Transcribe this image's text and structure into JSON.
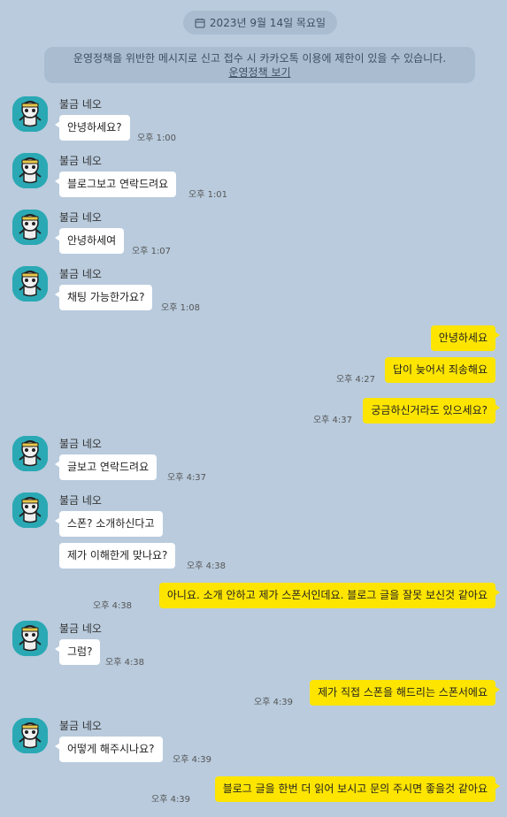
{
  "date_label": "2023년 9월 14일 목요일",
  "notice": {
    "text": "운영정책을 위반한 메시지로 신고 접수 시 카카오톡 이용에 제한이 있을 수 있습니다.",
    "link": "운영정책 보기"
  },
  "sender_name": "불금 네오",
  "messages": [
    {
      "text": "안녕하세요?",
      "time": "오후 1:00"
    },
    {
      "text": "블로그보고 연락드려요",
      "time": "오후 1:01"
    },
    {
      "text": "안녕하세여",
      "time": "오후 1:07"
    },
    {
      "text": "채팅 가능한가요?",
      "time": "오후 1:08"
    },
    {
      "text": "안녕하세요"
    },
    {
      "text": "답이 늦어서 죄송해요",
      "time": "오후 4:27"
    },
    {
      "text": "궁금하신거라도 있으세요?",
      "time": "오후 4:37"
    },
    {
      "text": "글보고 연락드려요",
      "time": "오후 4:37"
    },
    {
      "text": "스폰? 소개하신다고"
    },
    {
      "text": "제가 이해한게 맞나요?",
      "time": "오후 4:38"
    },
    {
      "text": "아니요. 소개 안하고 제가 스폰서인데요. 블로그 글을 잘못 보신것 같아요",
      "time": "오후 4:38"
    },
    {
      "text": "그럼?",
      "time": "오후 4:38"
    },
    {
      "text": "제가 직접 스폰을 해드리는 스폰서에요",
      "time": "오후 4:39"
    },
    {
      "text": "어떻게 해주시나요?",
      "time": "오후 4:39"
    },
    {
      "text": "블로그 글을 한번 더 읽어 보시고 문의 주시면 좋을것 같아요",
      "time": "오후 4:39"
    }
  ],
  "colors": {
    "background": "#b9cbdd",
    "incoming_bubble": "#ffffff",
    "outgoing_bubble": "#fee500",
    "avatar_bg": "#2aa9b4"
  }
}
